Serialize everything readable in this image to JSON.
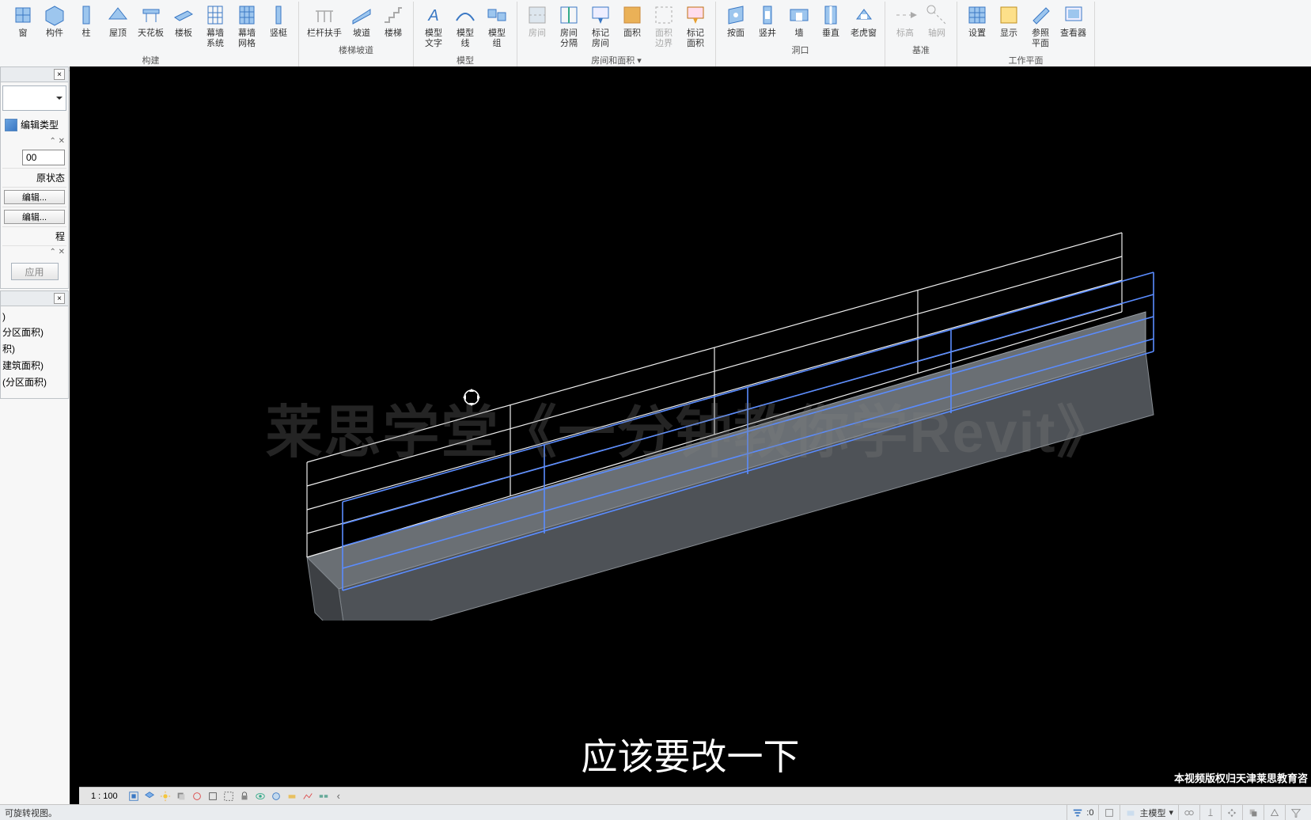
{
  "ribbon": {
    "groups": [
      {
        "title": "构建",
        "items": [
          {
            "id": "window",
            "label": "窗"
          },
          {
            "id": "component",
            "label": "构件"
          },
          {
            "id": "column",
            "label": "柱"
          },
          {
            "id": "roof",
            "label": "屋顶"
          },
          {
            "id": "ceiling",
            "label": "天花板"
          },
          {
            "id": "floor",
            "label": "楼板"
          },
          {
            "id": "curtain-system",
            "label": "幕墙\n系统"
          },
          {
            "id": "curtain-grid",
            "label": "幕墙\n网格"
          },
          {
            "id": "mullion",
            "label": "竖梃"
          }
        ]
      },
      {
        "title": "楼梯坡道",
        "items": [
          {
            "id": "railing",
            "label": "栏杆扶手"
          },
          {
            "id": "ramp",
            "label": "坡道"
          },
          {
            "id": "stair",
            "label": "楼梯"
          }
        ]
      },
      {
        "title": "模型",
        "items": [
          {
            "id": "model-text",
            "label": "模型\n文字"
          },
          {
            "id": "model-line",
            "label": "模型\n线"
          },
          {
            "id": "model-group",
            "label": "模型\n组"
          }
        ]
      },
      {
        "title": "房间和面积 ▾",
        "items": [
          {
            "id": "room",
            "label": "房间",
            "disabled": true
          },
          {
            "id": "room-separator",
            "label": "房间\n分隔"
          },
          {
            "id": "tag-room",
            "label": "标记\n房间"
          },
          {
            "id": "area",
            "label": "面积"
          },
          {
            "id": "area-boundary",
            "label": "面积\n边界",
            "disabled": true
          },
          {
            "id": "tag-area",
            "label": "标记\n面积"
          }
        ]
      },
      {
        "title": "洞口",
        "items": [
          {
            "id": "by-face",
            "label": "按面"
          },
          {
            "id": "shaft",
            "label": "竖井"
          },
          {
            "id": "wall-opening",
            "label": "墙"
          },
          {
            "id": "vertical",
            "label": "垂直"
          },
          {
            "id": "dormer",
            "label": "老虎窗"
          }
        ]
      },
      {
        "title": "基准",
        "items": [
          {
            "id": "level",
            "label": "标高",
            "disabled": true
          },
          {
            "id": "grid",
            "label": "轴网",
            "disabled": true
          }
        ]
      },
      {
        "title": "工作平面",
        "items": [
          {
            "id": "set",
            "label": "设置"
          },
          {
            "id": "show",
            "label": "显示"
          },
          {
            "id": "ref-plane",
            "label": "参照\n平面"
          },
          {
            "id": "viewer",
            "label": "查看器"
          }
        ]
      }
    ]
  },
  "properties": {
    "edit_type_label": "编辑类型",
    "value_field": "00",
    "rows": [
      {
        "kind": "text",
        "value": "原状态"
      },
      {
        "kind": "button",
        "value": "编辑..."
      },
      {
        "kind": "button",
        "value": "编辑..."
      },
      {
        "kind": "text",
        "value": "程"
      }
    ],
    "apply_label": "应用"
  },
  "browser": {
    "items": [
      ")",
      "分区面积)",
      "积)",
      "建筑面积)",
      "(分区面积)"
    ]
  },
  "viewport": {
    "watermark": "莱思学堂《一分钟教你学Revit》",
    "subtitle": "应该要改一下",
    "copyright": "本视频版权归天津莱思教育咨"
  },
  "view_controls": {
    "scale": "1 : 100"
  },
  "status": {
    "hint": "可旋转视图。",
    "zero": ":0",
    "model": "主模型"
  }
}
